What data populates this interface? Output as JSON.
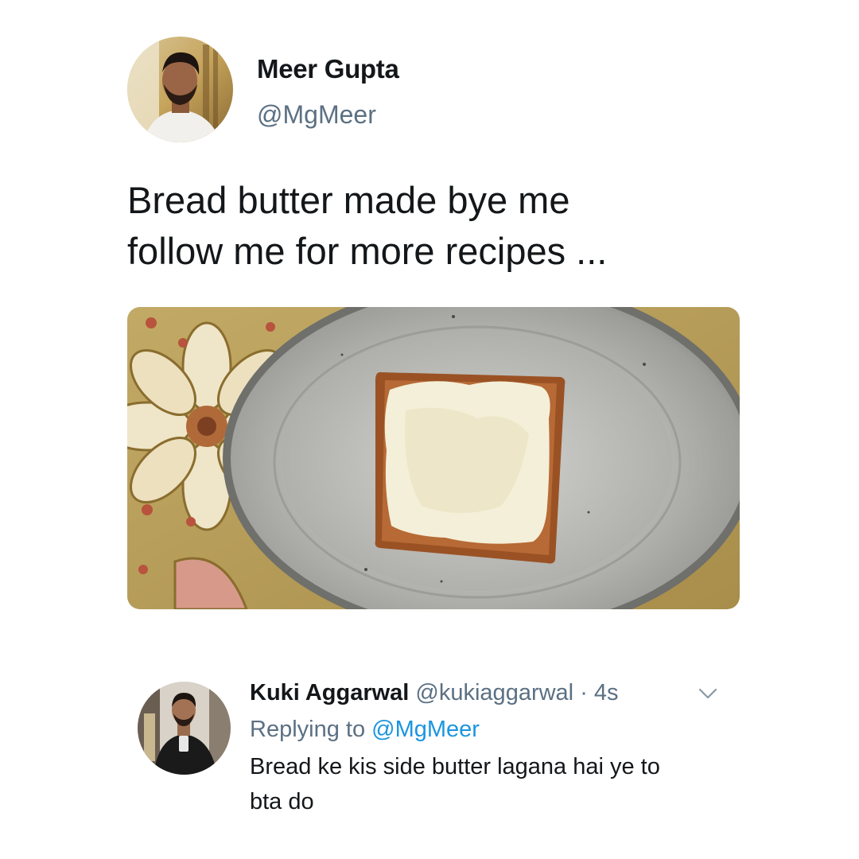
{
  "tweet": {
    "author": {
      "name": "Meer Gupta",
      "handle": "@MgMeer"
    },
    "text_lines": [
      "Bread butter made bye me",
      "follow me for more recipes ..."
    ],
    "media": {
      "description_icon": "photo-bread-butter-plate"
    }
  },
  "reply": {
    "author": {
      "name": "Kuki Aggarwal",
      "handle": "@kukiaggarwal"
    },
    "separator": "·",
    "time": "4s",
    "replying_prefix": "Replying to",
    "replying_to": "@MgMeer",
    "text_lines": [
      "Bread ke kis side butter lagana hai ye to",
      "bta do"
    ]
  },
  "colors": {
    "primary_text": "#14171a",
    "secondary_text": "#5b7083",
    "link": "#1b95e0",
    "background": "#ffffff"
  }
}
